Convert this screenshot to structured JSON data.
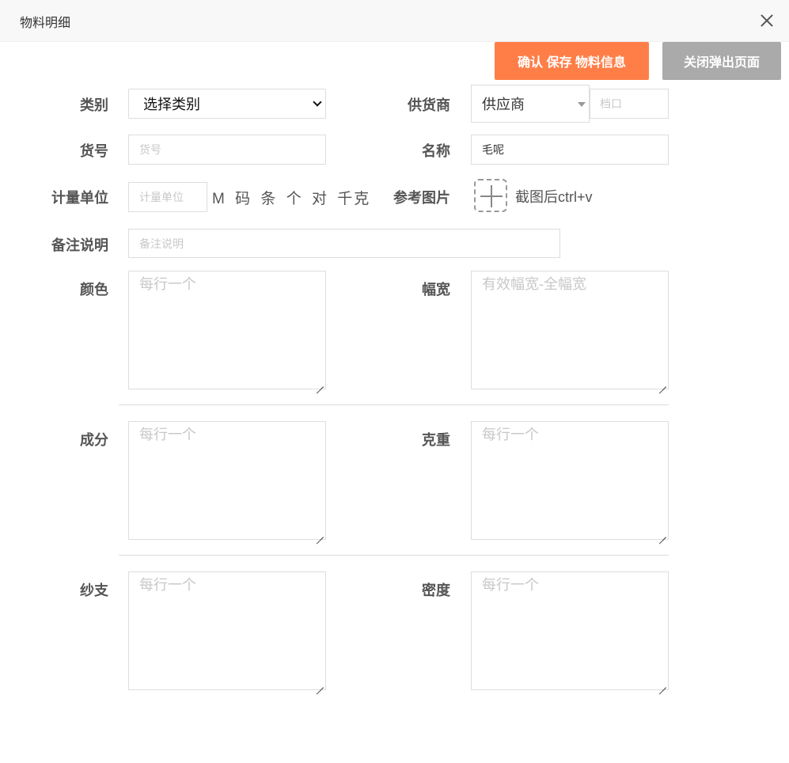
{
  "dialog": {
    "title": "物料明细",
    "close_icon": "close-icon"
  },
  "actions": {
    "save_label": "确认 保存 物料信息",
    "close_label": "关闭弹出页面",
    "save_color": "#ff7e48",
    "close_color": "#aaaaaa"
  },
  "form": {
    "category": {
      "label": "类别",
      "value": "选择类别"
    },
    "supplier": {
      "label": "供货商",
      "value": "供应商",
      "stall_placeholder": "档口"
    },
    "item_no": {
      "label": "货号",
      "placeholder": "货号"
    },
    "name": {
      "label": "名称",
      "value": "毛呢"
    },
    "unit": {
      "label": "计量单位",
      "placeholder": "计量单位",
      "options": [
        "M",
        "码",
        "条",
        "个",
        "对",
        "千克"
      ]
    },
    "ref_image": {
      "label": "参考图片",
      "hint": "截图后ctrl+v"
    },
    "remark": {
      "label": "备注说明",
      "placeholder": "备注说明"
    },
    "color": {
      "label": "颜色",
      "placeholder": "每行一个"
    },
    "width": {
      "label": "幅宽",
      "placeholder": "有效幅宽-全幅宽"
    },
    "composition": {
      "label": "成分",
      "placeholder": "每行一个"
    },
    "weight": {
      "label": "克重",
      "placeholder": "每行一个"
    },
    "yarn": {
      "label": "纱支",
      "placeholder": "每行一个"
    },
    "density": {
      "label": "密度",
      "placeholder": "每行一个"
    }
  }
}
